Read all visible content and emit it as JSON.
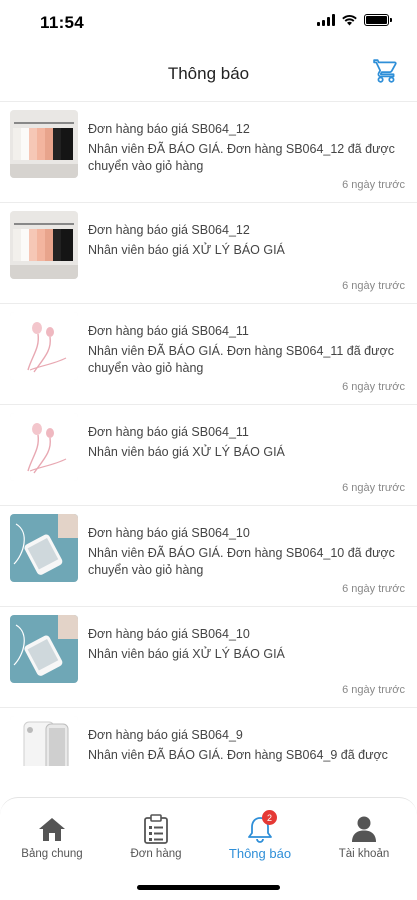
{
  "status_bar": {
    "time": "11:54"
  },
  "header": {
    "title": "Thông báo",
    "cart_icon": "shopping-cart-icon"
  },
  "notifications": [
    {
      "title": "Đơn hàng báo giá SB064_12",
      "message": "Nhân viên ĐÃ BÁO GIÁ. Đơn hàng SB064_12 đã được chuyển vào giỏ hàng",
      "time": "6 ngày trước",
      "image": "clothes-rack"
    },
    {
      "title": "Đơn hàng báo giá SB064_12",
      "message": "Nhân viên báo giá XỬ LÝ BÁO GIÁ",
      "time": "6 ngày trước",
      "image": "clothes-rack"
    },
    {
      "title": "Đơn hàng báo giá SB064_11",
      "message": "Nhân viên ĐÃ BÁO GIÁ. Đơn hàng SB064_11 đã được chuyển vào giỏ hàng",
      "time": "6 ngày trước",
      "image": "pink-earphones"
    },
    {
      "title": "Đơn hàng báo giá SB064_11",
      "message": "Nhân viên báo giá XỬ LÝ BÁO GIÁ",
      "time": "6 ngày trước",
      "image": "pink-earphones"
    },
    {
      "title": "Đơn hàng báo giá SB064_10",
      "message": "Nhân viên ĐÃ BÁO GIÁ. Đơn hàng SB064_10 đã được chuyển vào giỏ hàng",
      "time": "6 ngày trước",
      "image": "phone-on-blue"
    },
    {
      "title": "Đơn hàng báo giá SB064_10",
      "message": "Nhân viên báo giá XỬ LÝ BÁO GIÁ",
      "time": "6 ngày trước",
      "image": "phone-on-blue"
    },
    {
      "title": "Đơn hàng báo giá SB064_9",
      "message": "Nhân viên ĐÃ BÁO GIÁ. Đơn hàng SB064_9 đã được",
      "time": "",
      "image": "white-iphone"
    }
  ],
  "tabbar": {
    "tabs": [
      {
        "label": "Bảng chung",
        "icon": "home-icon"
      },
      {
        "label": "Đơn hàng",
        "icon": "clipboard-icon"
      },
      {
        "label": "Thông báo",
        "icon": "bell-icon",
        "badge": "2",
        "active": true
      },
      {
        "label": "Tài khoản",
        "icon": "user-icon"
      }
    ]
  },
  "colors": {
    "accent": "#2f8fd8",
    "badge": "#e53935",
    "divider": "#ececec"
  }
}
